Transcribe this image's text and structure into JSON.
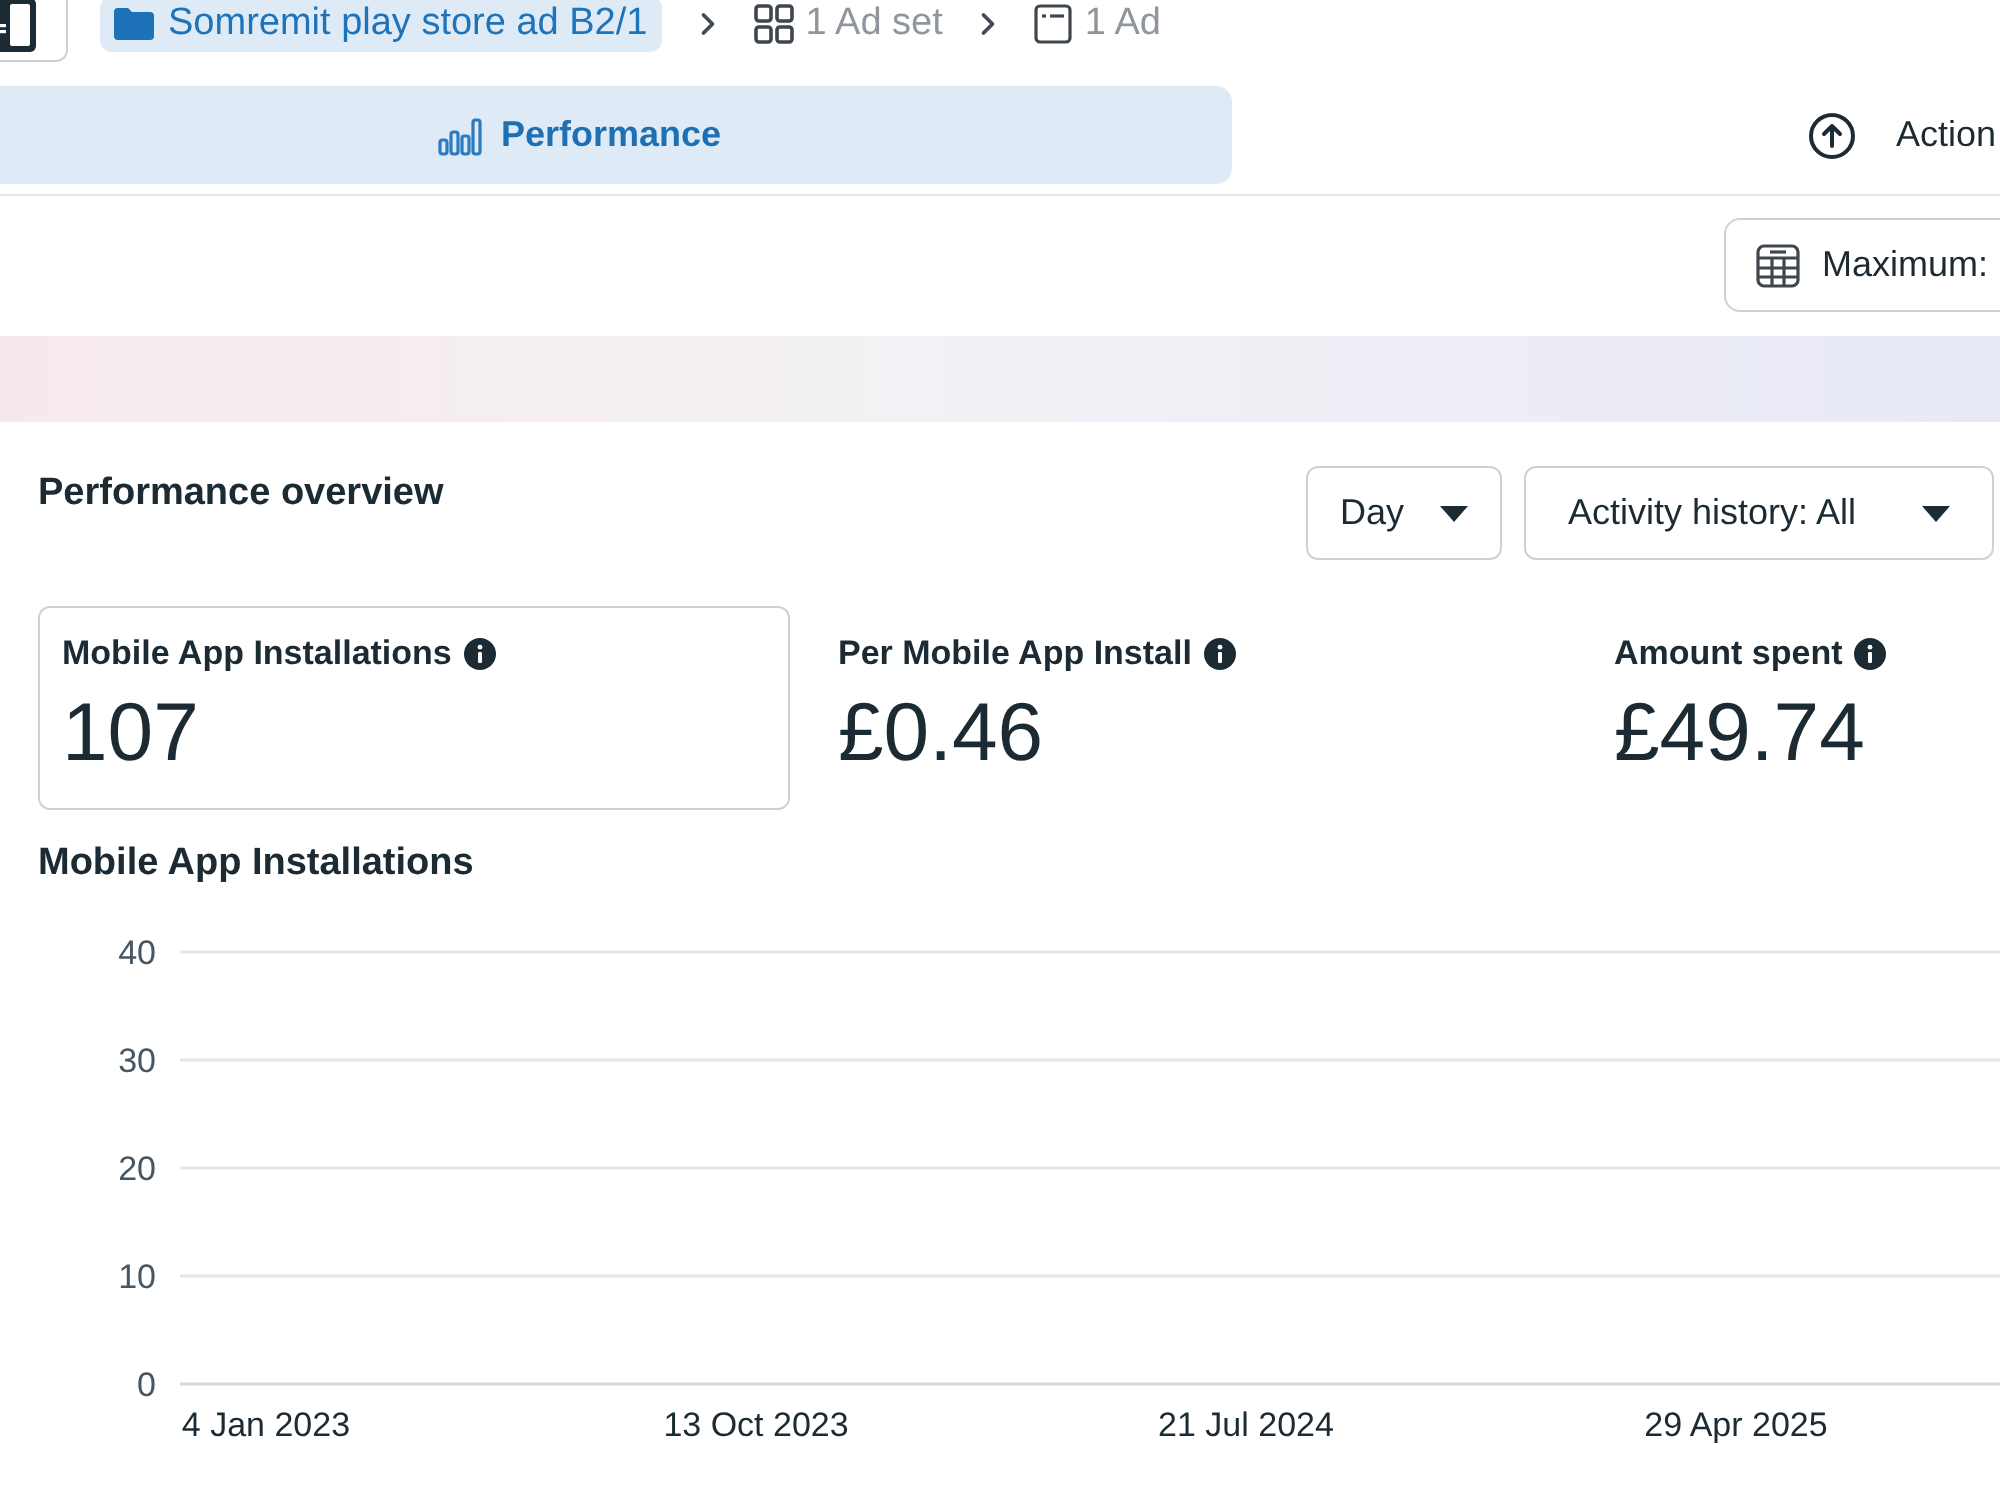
{
  "top_bar": {
    "breadcrumbs": [
      {
        "kind": "campaign",
        "label": "Somremit play store ad B2/1",
        "selected": true
      },
      {
        "kind": "ad_set",
        "label": "1 Ad set",
        "selected": false
      },
      {
        "kind": "ad",
        "label": "1 Ad",
        "selected": false
      }
    ]
  },
  "tabs": [
    {
      "label": "Performance",
      "selected": true
    }
  ],
  "actions_button": {
    "label": "Action"
  },
  "columns_button": {
    "label": "Maximum:"
  },
  "overview": {
    "title": "Performance overview",
    "filters": [
      {
        "label": "Day"
      },
      {
        "label": "Activity history: All"
      }
    ],
    "metrics": [
      {
        "label": "Mobile App Installations",
        "value": "107",
        "selected": true
      },
      {
        "label": "Per Mobile App Install",
        "value": "£0.46",
        "selected": false
      },
      {
        "label": "Amount spent",
        "value": "£49.74",
        "selected": false
      }
    ]
  },
  "chart": {
    "chart_data": {
      "type": "line",
      "title": "Mobile App Installations",
      "categories": [
        "4 Jan 2023",
        "13 Oct 2023",
        "21 Jul 2024",
        "29 Apr 2025"
      ],
      "ylim": [
        0,
        40
      ],
      "yticks": [
        0,
        10,
        20,
        30,
        40
      ],
      "grid": true
    }
  }
}
